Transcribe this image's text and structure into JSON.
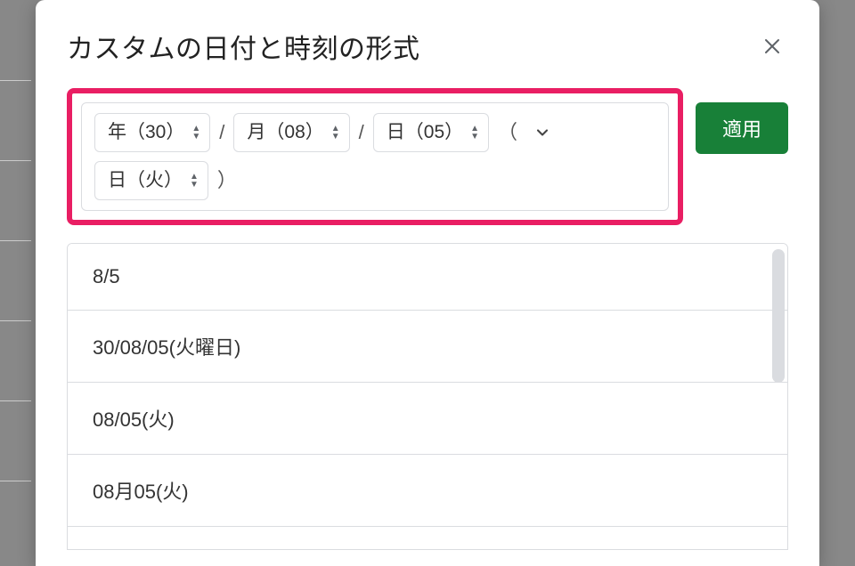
{
  "dialog": {
    "title": "カスタムの日付と時刻の形式",
    "apply_label": "適用"
  },
  "builder": {
    "tokens": [
      {
        "label": "年（30）"
      },
      {
        "sep": "/"
      },
      {
        "label": "月（08）"
      },
      {
        "sep": "/"
      },
      {
        "label": "日（05）"
      },
      {
        "sep": "（"
      },
      {
        "label": "日（火）"
      },
      {
        "sep": "）"
      }
    ]
  },
  "format_options": [
    "8/5",
    "30/08/05(火曜日)",
    "08/05(火)",
    "08月05(火)"
  ]
}
